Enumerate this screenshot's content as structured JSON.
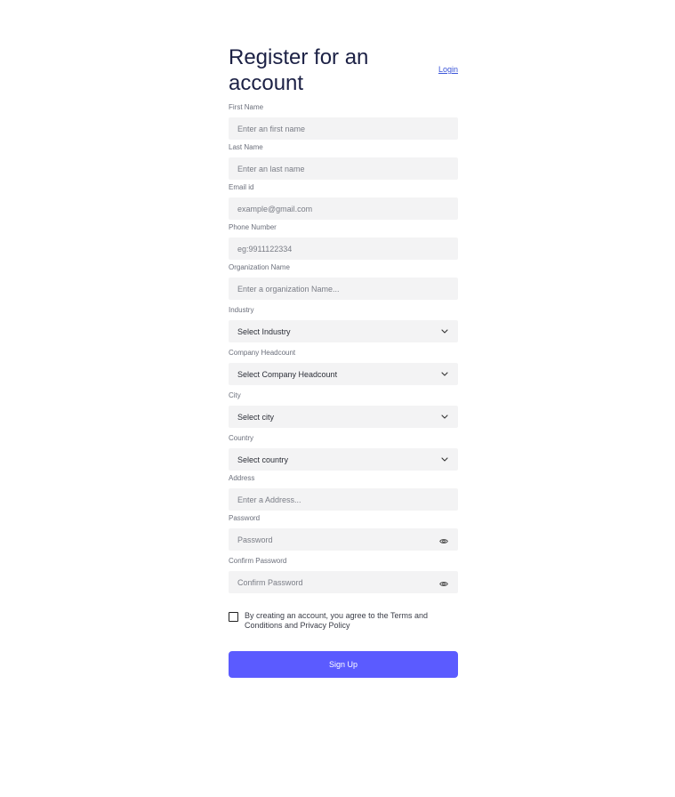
{
  "header": {
    "title": "Register for an account",
    "login_label": "Login"
  },
  "fields": {
    "first_name": {
      "label": "First Name",
      "placeholder": "Enter an first name"
    },
    "last_name": {
      "label": "Last Name",
      "placeholder": "Enter an last name"
    },
    "email": {
      "label": "Email id",
      "placeholder": "example@gmail.com"
    },
    "phone": {
      "label": "Phone Number",
      "placeholder": "eg:9911122334"
    },
    "organization": {
      "label": "Organization Name",
      "placeholder": "Enter a organization Name..."
    },
    "industry": {
      "label": "Industry",
      "value": "Select Industry",
      "icon": "chevron-down-icon"
    },
    "headcount": {
      "label": "Company Headcount",
      "value": "Select Company Headcount",
      "icon": "chevron-down-icon"
    },
    "city": {
      "label": "City",
      "value": "Select city",
      "icon": "chevron-down-icon"
    },
    "country": {
      "label": "Country",
      "value": "Select country",
      "icon": "chevron-down-icon"
    },
    "address": {
      "label": "Address",
      "placeholder": "Enter a Address..."
    },
    "password": {
      "label": "Password",
      "placeholder": "Password",
      "icon": "eye-icon"
    },
    "confirm_password": {
      "label": "Confirm Password",
      "placeholder": "Confirm Password",
      "icon": "eye-icon"
    }
  },
  "terms": {
    "checked": false,
    "text": "By creating an account, you agree to the Terms and Conditions and Privacy Policy"
  },
  "signup": {
    "label": "Sign Up"
  },
  "colors": {
    "primary": "#5b5bff",
    "link": "#3b55d9",
    "input_bg": "#f3f3f4",
    "title": "#1c2145"
  }
}
